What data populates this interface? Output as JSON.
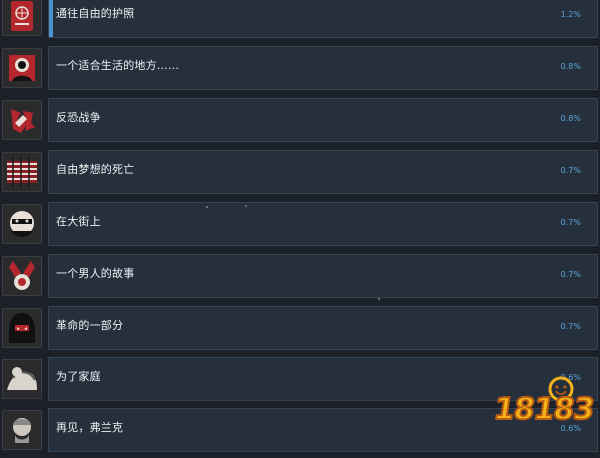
{
  "achievements": [
    {
      "title": "通往自由的护照",
      "percent": "1.2%",
      "progress": 0.012,
      "icon": "passport-icon"
    },
    {
      "title": "一个适合生活的地方……",
      "percent": "0.8%",
      "progress": 0.008,
      "icon": "portrait-icon"
    },
    {
      "title": "反恐战争",
      "percent": "0.8%",
      "progress": 0.008,
      "icon": "emblem-icon"
    },
    {
      "title": "自由梦想的死亡",
      "percent": "0.7%",
      "progress": 0.007,
      "icon": "striped-ribbon-icon"
    },
    {
      "title": "在大街上",
      "percent": "0.7%",
      "progress": 0.007,
      "icon": "masked-face-icon"
    },
    {
      "title": "一个男人的故事",
      "percent": "0.7%",
      "progress": 0.007,
      "icon": "medal-ribbon-icon"
    },
    {
      "title": "革命的一部分",
      "percent": "0.7%",
      "progress": 0.007,
      "icon": "hooded-figure-icon"
    },
    {
      "title": "为了家庭",
      "percent": "0.6%",
      "progress": 0.006,
      "icon": "embrace-icon"
    },
    {
      "title": "再见，弗兰克",
      "percent": "0.6%",
      "progress": 0.006,
      "icon": "old-man-icon"
    }
  ],
  "watermark": {
    "text": "18183"
  },
  "colors": {
    "background": "#1c2129",
    "row": "#25303c",
    "percent": "#5aa6da",
    "accent_red": "#b3272d"
  }
}
